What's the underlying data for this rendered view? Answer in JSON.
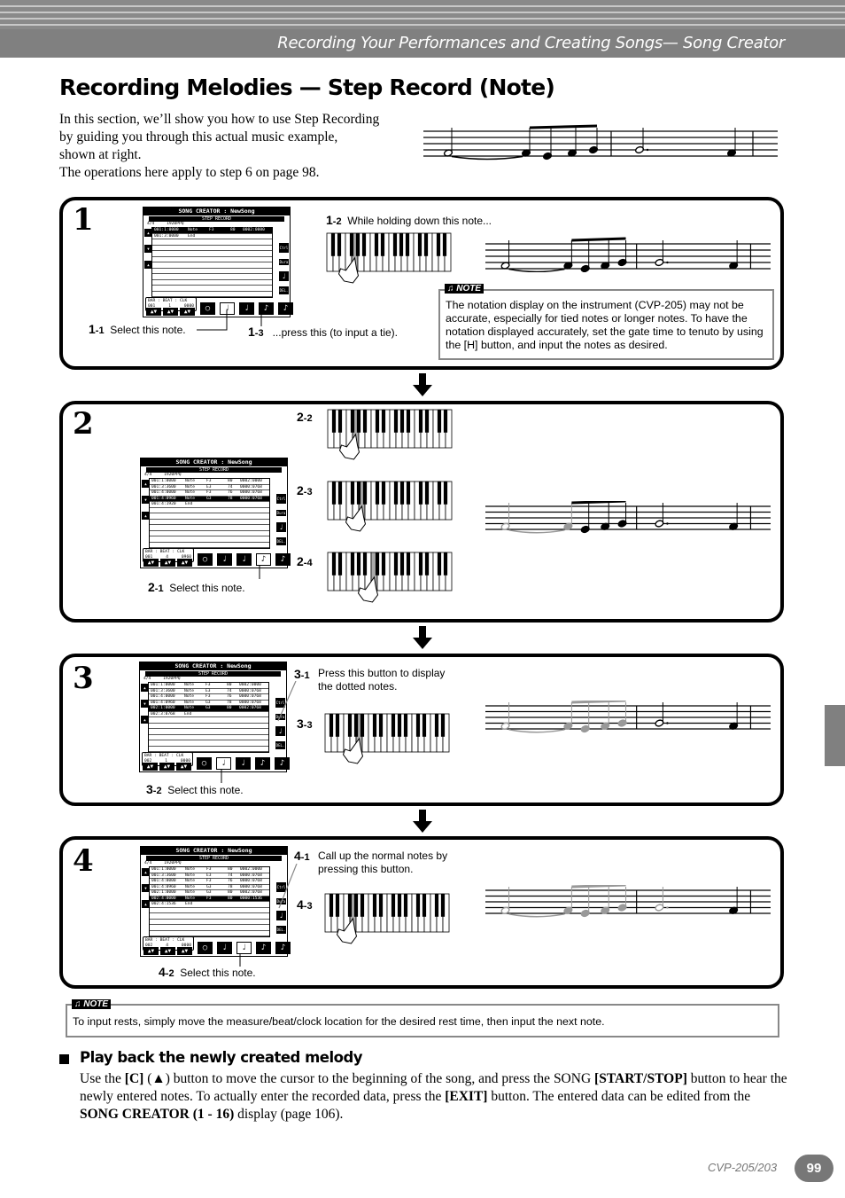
{
  "header": {
    "section_title": "Recording Your Performances and Creating Songs— Song Creator"
  },
  "page_title": "Recording Melodies — Step Record (Note)",
  "intro": [
    "In this section, we’ll show you how to use Step Recording",
    "by guiding you through this actual music example,",
    "shown at right.",
    "The operations here apply to step 6 on page 98."
  ],
  "lcd_common": {
    "title": "SONG CREATOR : NewSong",
    "subtitle": "STEP RECORD",
    "meter": "4/4",
    "ppq": "1920PPQ",
    "counter_labels": "BAR : BEAT : CLK",
    "side_buttons": [
      "Ctrl Vel.",
      "Dura.",
      "DEL."
    ]
  },
  "steps": [
    {
      "number": "1",
      "lcd": {
        "rows": [
          {
            "pos": "001:1:0000",
            "type": "Note",
            "note": "F3",
            "vel": "80",
            "gate": "0002:0000",
            "selected": true
          },
          {
            "pos": "001:3:0000",
            "type": "End",
            "note": "",
            "vel": "",
            "gate": "",
            "selected": false
          }
        ],
        "counter": {
          "bar": "001",
          "beat": "1",
          "clk": "0000"
        },
        "highlight_button": 1
      },
      "labels": [
        {
          "id": "1-1",
          "major": "1",
          "minor": "-1",
          "text": "Select this note."
        },
        {
          "id": "1-2",
          "major": "1",
          "minor": "-2",
          "text": "While holding down this note..."
        },
        {
          "id": "1-3",
          "major": "1",
          "minor": "-3",
          "text": "...press this (to input a tie)."
        }
      ],
      "note": {
        "tag": "NOTE",
        "text": "The notation display on the instrument (CVP-205) may not be accurate, especially for tied notes or longer notes. To have the notation displayed accurately, set the gate time to tenuto by using the [H] button, and input the notes as desired."
      }
    },
    {
      "number": "2",
      "lcd": {
        "rows": [
          {
            "pos": "001:1:0000",
            "type": "Note",
            "note": "F3",
            "vel": "80",
            "gate": "0002:0000",
            "selected": false
          },
          {
            "pos": "001:3:3600",
            "type": "Note",
            "note": "E3",
            "vel": "74",
            "gate": "0000:0768",
            "selected": false
          },
          {
            "pos": "001:4:0000",
            "type": "Note",
            "note": "F3",
            "vel": "76",
            "gate": "0000:0768",
            "selected": false
          },
          {
            "pos": "001:4:0960",
            "type": "Note",
            "note": "G3",
            "vel": "78",
            "gate": "0000:0768",
            "selected": true
          },
          {
            "pos": "001:4:1920",
            "type": "End",
            "note": "",
            "vel": "",
            "gate": "",
            "selected": false
          }
        ],
        "counter": {
          "bar": "001",
          "beat": "4",
          "clk": "0960"
        },
        "highlight_button": 3
      },
      "labels": [
        {
          "id": "2-1",
          "major": "2",
          "minor": "-1",
          "text": "Select this note."
        },
        {
          "id": "2-2",
          "major": "2",
          "minor": "-2",
          "text": ""
        },
        {
          "id": "2-3",
          "major": "2",
          "minor": "-3",
          "text": ""
        },
        {
          "id": "2-4",
          "major": "2",
          "minor": "-4",
          "text": ""
        }
      ]
    },
    {
      "number": "3",
      "lcd": {
        "rows": [
          {
            "pos": "001:1:0000",
            "type": "Note",
            "note": "F3",
            "vel": "80",
            "gate": "0002:0000",
            "selected": false
          },
          {
            "pos": "001:3:3600",
            "type": "Note",
            "note": "E3",
            "vel": "74",
            "gate": "0000:0768",
            "selected": false
          },
          {
            "pos": "001:4:0000",
            "type": "Note",
            "note": "F3",
            "vel": "76",
            "gate": "0000:0768",
            "selected": false
          },
          {
            "pos": "001:4:0960",
            "type": "Note",
            "note": "G3",
            "vel": "78",
            "gate": "0000:0768",
            "selected": false
          },
          {
            "pos": "002:1:0000",
            "type": "Note",
            "note": "G3",
            "vel": "80",
            "gate": "0002:0768",
            "selected": true
          },
          {
            "pos": "002:3:0768",
            "type": "End",
            "note": "",
            "vel": "",
            "gate": "",
            "selected": false
          }
        ],
        "counter": {
          "bar": "002",
          "beat": "1",
          "clk": "0000"
        },
        "highlight_button": 1
      },
      "labels": [
        {
          "id": "3-1",
          "major": "3",
          "minor": "-1",
          "text": "Press this button to display the dotted notes."
        },
        {
          "id": "3-2",
          "major": "3",
          "minor": "-2",
          "text": "Select this note."
        },
        {
          "id": "3-3",
          "major": "3",
          "minor": "-3",
          "text": ""
        }
      ]
    },
    {
      "number": "4",
      "lcd": {
        "rows": [
          {
            "pos": "001:1:0000",
            "type": "Note",
            "note": "F3",
            "vel": "80",
            "gate": "0002:0000",
            "selected": false
          },
          {
            "pos": "001:3:3600",
            "type": "Note",
            "note": "E3",
            "vel": "74",
            "gate": "0000:0768",
            "selected": false
          },
          {
            "pos": "001:4:0000",
            "type": "Note",
            "note": "F3",
            "vel": "76",
            "gate": "0000:0768",
            "selected": false
          },
          {
            "pos": "001:4:0960",
            "type": "Note",
            "note": "G3",
            "vel": "78",
            "gate": "0000:0768",
            "selected": false
          },
          {
            "pos": "002:1:0000",
            "type": "Note",
            "note": "G3",
            "vel": "80",
            "gate": "0002:0768",
            "selected": false
          },
          {
            "pos": "002:4:0000",
            "type": "Note",
            "note": "F3",
            "vel": "80",
            "gate": "0000:1536",
            "selected": true
          },
          {
            "pos": "002:4:1536",
            "type": "End",
            "note": "",
            "vel": "",
            "gate": "",
            "selected": false
          }
        ],
        "counter": {
          "bar": "002",
          "beat": "4",
          "clk": "0000"
        },
        "highlight_button": 2
      },
      "labels": [
        {
          "id": "4-1",
          "major": "4",
          "minor": "-1",
          "text": "Call up the normal notes by pressing this button."
        },
        {
          "id": "4-2",
          "major": "4",
          "minor": "-2",
          "text": "Select this note."
        },
        {
          "id": "4-3",
          "major": "4",
          "minor": "-3",
          "text": ""
        }
      ]
    }
  ],
  "bottom_note": {
    "tag": "NOTE",
    "text": "To input rests, simply move the measure/beat/clock location for the desired rest time, then input the next note."
  },
  "playback": {
    "heading": "Play back the newly created melody",
    "segments": [
      {
        "t": "Use the ",
        "b": false
      },
      {
        "t": "[C]",
        "b": true
      },
      {
        "t": " (",
        "b": false
      },
      {
        "t": "▲",
        "b": true
      },
      {
        "t": ") button to move the cursor to the beginning of the song, and press the SONG ",
        "b": false
      },
      {
        "t": "[START/STOP]",
        "b": true
      },
      {
        "t": " button to hear the newly entered notes. To actually enter the recorded data, press the ",
        "b": false
      },
      {
        "t": "[EXIT]",
        "b": true
      },
      {
        "t": " button. The entered data can be edited from the ",
        "b": false
      },
      {
        "t": "SONG CREATOR (1 - 16)",
        "b": true
      },
      {
        "t": " display (page 106).",
        "b": false
      }
    ]
  },
  "footer": {
    "model": "CVP-205/203",
    "page_number": "99"
  }
}
